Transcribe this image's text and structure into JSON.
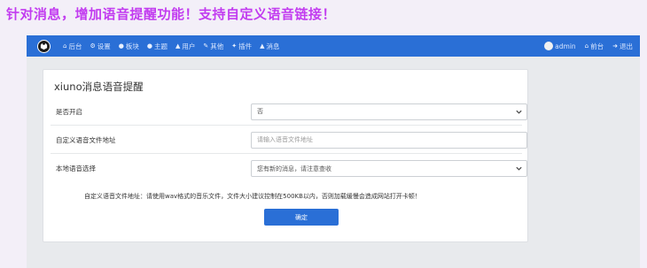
{
  "banner": "针对消息，增加语音提醒功能！支持自定义语音链接！",
  "nav": {
    "items": [
      {
        "icon": "home-icon",
        "glyph": "⌂",
        "label": "后台"
      },
      {
        "icon": "gear-icon",
        "glyph": "⚙",
        "label": "设置"
      },
      {
        "icon": "chat-icon",
        "glyph": "●",
        "label": "板块"
      },
      {
        "icon": "comment-icon",
        "glyph": "●",
        "label": "主题"
      },
      {
        "icon": "user-icon",
        "glyph": "▲",
        "label": "用户"
      },
      {
        "icon": "wrench-icon",
        "glyph": "✎",
        "label": "其他"
      },
      {
        "icon": "plugin-icon",
        "glyph": "✦",
        "label": "插件"
      },
      {
        "icon": "bell-icon",
        "glyph": "▲",
        "label": "消息"
      }
    ],
    "right": [
      {
        "icon": "avatar-icon",
        "label": "admin"
      },
      {
        "icon": "home-icon",
        "glyph": "⌂",
        "label": "前台"
      },
      {
        "icon": "logout-icon",
        "glyph": "➜",
        "label": "退出"
      }
    ]
  },
  "card": {
    "title": "xiuno消息语音提醒",
    "enable": {
      "label": "是否开启",
      "value": "否"
    },
    "custom_url": {
      "label": "自定义语音文件地址",
      "placeholder": "请输入语音文件地址"
    },
    "local": {
      "label": "本地语音选择",
      "value": "您有新的消息，请注意查收"
    },
    "hint": "自定义语音文件地址：请使用wav格式的音乐文件，文件大小建议控制在500KB以内，否则加载缓慢会造成网站打开卡顿！",
    "submit": "确定"
  }
}
